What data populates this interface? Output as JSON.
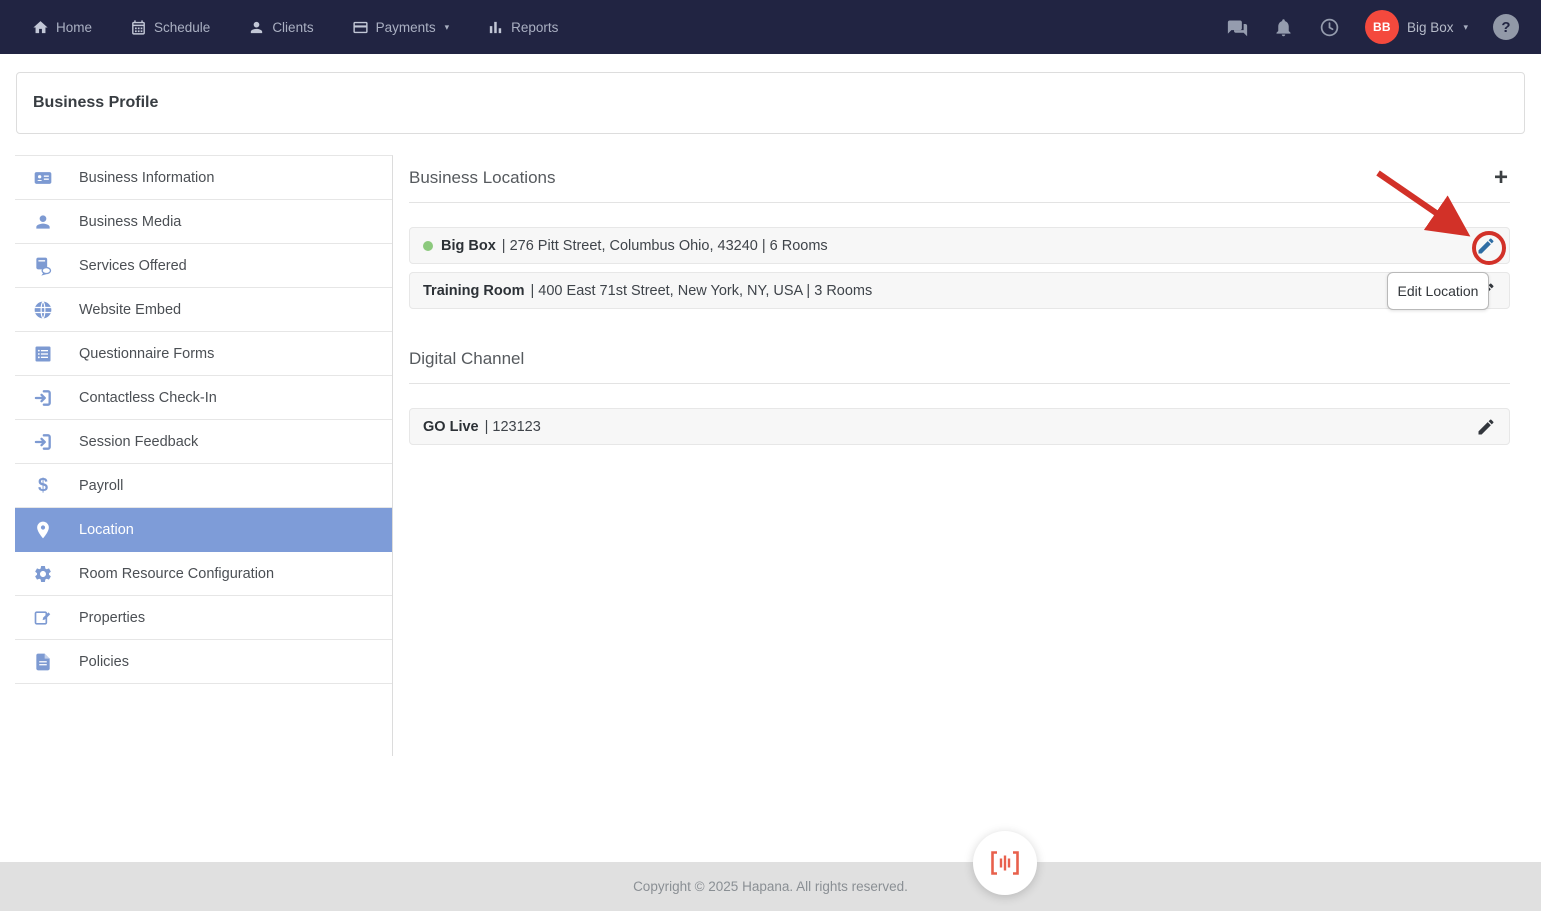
{
  "colors": {
    "nav_bg": "#212442",
    "accent_blue": "#7E9CD8",
    "sidebar_icon_blue": "#7D9AD2",
    "avatar_red": "#F4493D",
    "annotation_red": "#D23128",
    "status_green": "#8CC97D",
    "brand_orange": "#E8604C",
    "footer_bg": "#E0E0E0",
    "pencil_blue": "#2E6DA4"
  },
  "nav": {
    "items": [
      {
        "icon": "home-icon",
        "label": "Home"
      },
      {
        "icon": "calendar-icon",
        "label": "Schedule"
      },
      {
        "icon": "user-icon",
        "label": "Clients"
      },
      {
        "icon": "credit-card-icon",
        "label": "Payments"
      },
      {
        "icon": "bar-chart-icon",
        "label": "Reports"
      }
    ],
    "right": {
      "avatar_initials": "BB",
      "account_label": "Big Box",
      "help_glyph": "?"
    }
  },
  "icons": {
    "plus": "+",
    "caret_down": "▾",
    "dollar": "$"
  },
  "page": {
    "title": "Business Profile"
  },
  "sidebar": {
    "items": [
      {
        "icon": "id-card-icon",
        "label": "Business Information"
      },
      {
        "icon": "person-icon",
        "label": "Business Media"
      },
      {
        "icon": "book-chat-icon",
        "label": "Services Offered"
      },
      {
        "icon": "globe-icon",
        "label": "Website Embed"
      },
      {
        "icon": "list-icon",
        "label": "Questionnaire Forms"
      },
      {
        "icon": "sign-in-icon",
        "label": "Contactless Check-In"
      },
      {
        "icon": "sign-in-icon",
        "label": "Session Feedback"
      },
      {
        "icon": "dollar-icon",
        "label": "Payroll"
      },
      {
        "icon": "map-pin-icon",
        "label": "Location",
        "active": true
      },
      {
        "icon": "gear-icon",
        "label": "Room Resource Configuration"
      },
      {
        "icon": "edit-note-icon",
        "label": "Properties"
      },
      {
        "icon": "document-icon",
        "label": "Policies"
      }
    ]
  },
  "main": {
    "locations": {
      "title": "Business Locations",
      "rows": [
        {
          "name": "Big Box",
          "details": "| 276 Pitt Street, Columbus Ohio, 43240 | 6 Rooms",
          "status_dot": true
        },
        {
          "name": "Training Room",
          "details": "| 400 East 71st Street, New York, NY, USA | 3 Rooms",
          "status_dot": false
        }
      ]
    },
    "digital": {
      "title": "Digital Channel",
      "rows": [
        {
          "name": "GO Live",
          "details": "| 123123"
        }
      ]
    }
  },
  "tooltip": {
    "label": "Edit Location"
  },
  "footer": {
    "copyright": "Copyright © 2025 Hapana. All rights reserved."
  }
}
